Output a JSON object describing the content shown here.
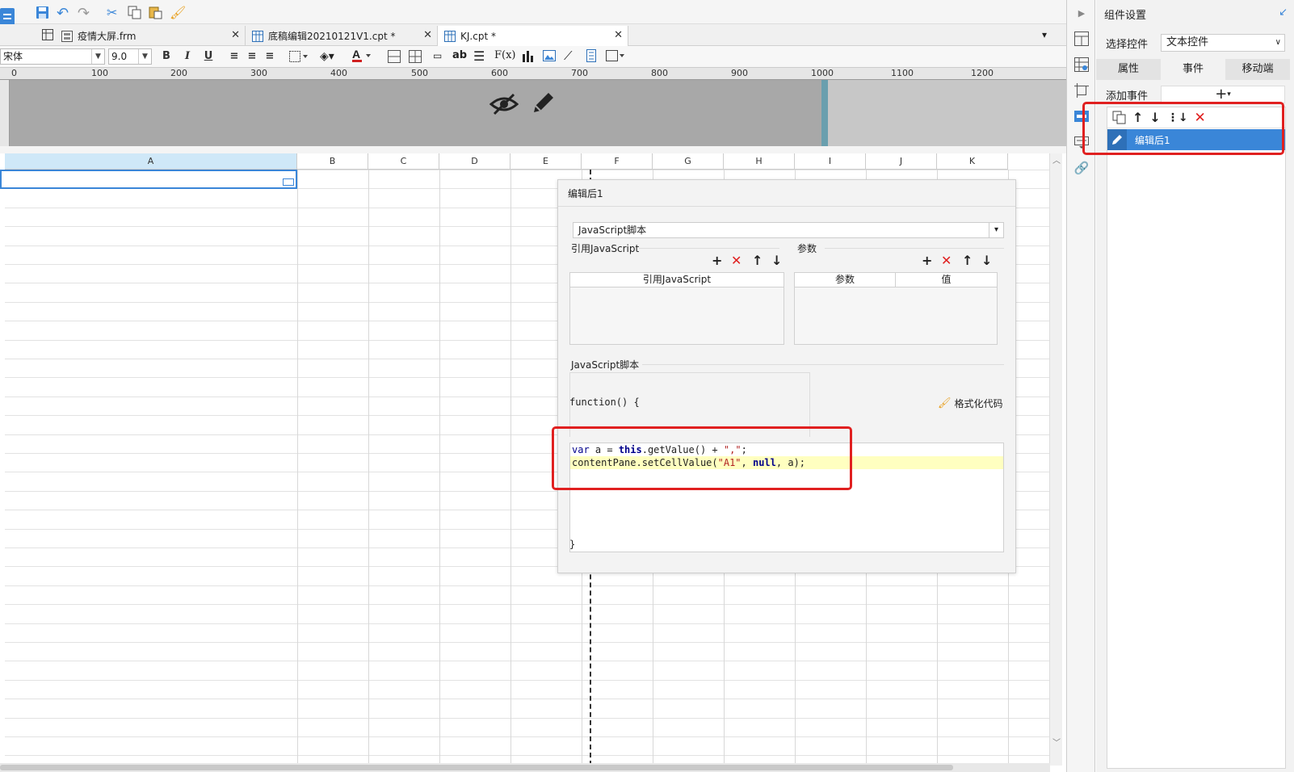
{
  "tabs": [
    {
      "label": "疫情大屏.frm",
      "active": false
    },
    {
      "label": "底稿编辑20210121V1.cpt *",
      "active": false
    },
    {
      "label": "KJ.cpt *",
      "active": true
    }
  ],
  "format": {
    "font": "宋体",
    "size": "9.0"
  },
  "ruler_labels": [
    "0",
    "100",
    "200",
    "300",
    "400",
    "500",
    "600",
    "700",
    "800",
    "900",
    "1000",
    "1100",
    "1200"
  ],
  "columns": [
    "A",
    "B",
    "C",
    "D",
    "E",
    "F",
    "G",
    "H",
    "I",
    "J",
    "K"
  ],
  "dialog": {
    "title": "编辑后1",
    "type_select": "JavaScript脚本",
    "ref_js_section": "引用JavaScript",
    "params_section": "参数",
    "ref_js_col": "引用JavaScript",
    "param_col": "参数",
    "value_col": "值",
    "script_section": "JavaScript脚本",
    "function_open": "function() {",
    "format_code": "格式化代码",
    "function_close": "}",
    "code": {
      "l1_kw": "var",
      "l1_a": " a = ",
      "l1_this": "this",
      "l1_b": ".getValue() + ",
      "l1_str": "\",\"",
      "l1_end": ";",
      "l2_a": "contentPane.setCellValue(",
      "l2_str": "\"A1\"",
      "l2_b": ", ",
      "l2_null": "null",
      "l2_end": ", a);"
    }
  },
  "panel": {
    "title": "组件设置",
    "select_label": "选择控件",
    "select_value": "文本控件",
    "tabs": [
      "属性",
      "事件",
      "移动端"
    ],
    "active_tab": "事件",
    "add_event": "添加事件",
    "event_item": "编辑后1"
  },
  "colors": {
    "accent": "#3a86d8",
    "highlight": "#e02020"
  }
}
